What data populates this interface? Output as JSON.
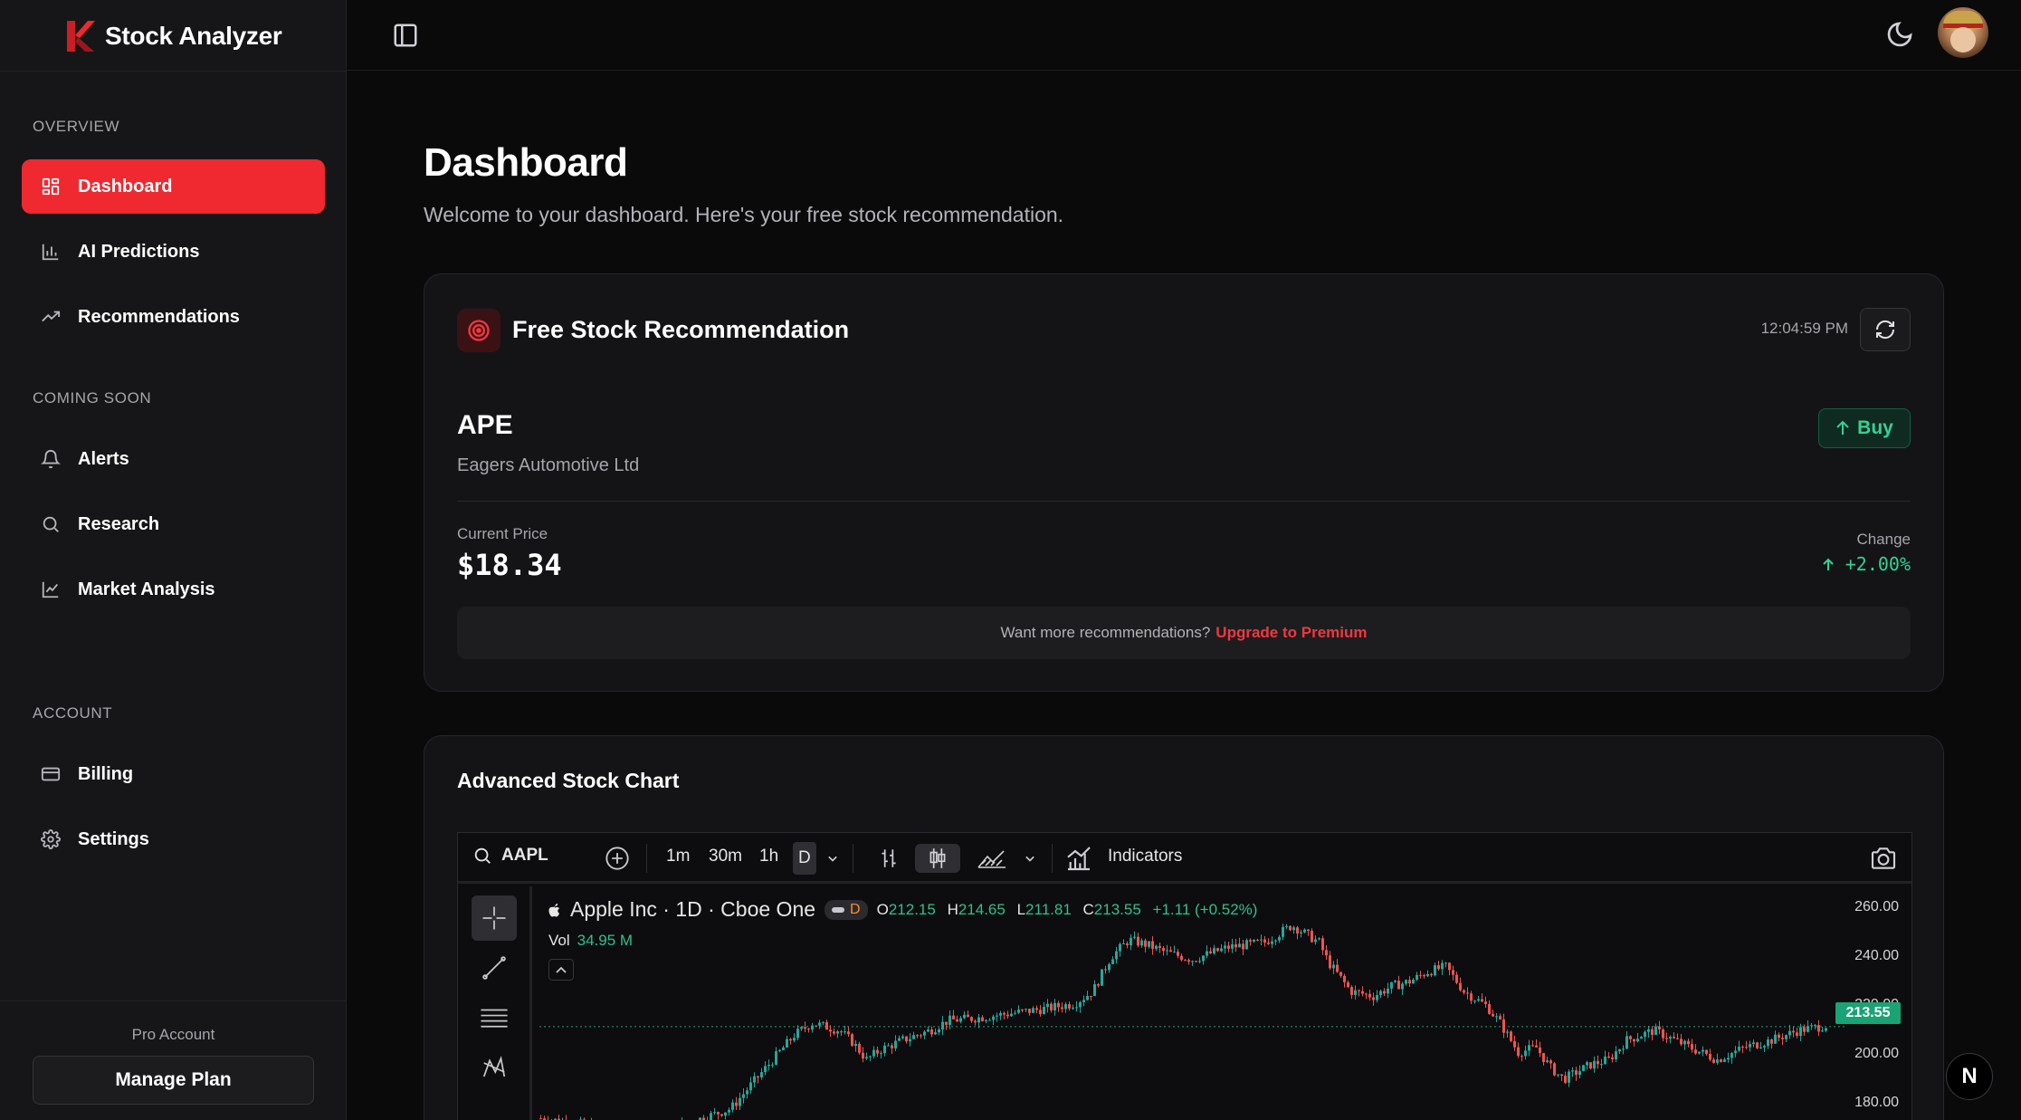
{
  "brand": {
    "name": "Stock Analyzer",
    "accent": "#f0282f"
  },
  "sidebar": {
    "sections": [
      {
        "title": "OVERVIEW",
        "items": [
          {
            "label": "Dashboard",
            "icon": "grid-icon",
            "active": true
          },
          {
            "label": "AI Predictions",
            "icon": "bar-chart-icon"
          },
          {
            "label": "Recommendations",
            "icon": "trending-up-icon"
          }
        ]
      },
      {
        "title": "COMING SOON",
        "items": [
          {
            "label": "Alerts",
            "icon": "bell-icon"
          },
          {
            "label": "Research",
            "icon": "search-icon"
          },
          {
            "label": "Market Analysis",
            "icon": "line-chart-icon"
          }
        ]
      },
      {
        "title": "ACCOUNT",
        "items": [
          {
            "label": "Billing",
            "icon": "credit-card-icon"
          },
          {
            "label": "Settings",
            "icon": "gear-icon"
          }
        ]
      }
    ],
    "footer": {
      "plan_label": "Pro Account",
      "manage_button": "Manage Plan"
    }
  },
  "main": {
    "title": "Dashboard",
    "subtitle": "Welcome to your dashboard. Here's your free stock recommendation."
  },
  "recommendation": {
    "title": "Free Stock Recommendation",
    "time": "12:04:59 PM",
    "ticker": "APE",
    "company": "Eagers Automotive Ltd",
    "action": "Buy",
    "price_label": "Current Price",
    "price": "$18.34",
    "change_label": "Change",
    "change": "+2.00%",
    "upgrade_text": "Want more recommendations?",
    "upgrade_link": "Upgrade to Premium",
    "positive_color": "#2fd596"
  },
  "advanced_chart": {
    "title": "Advanced Stock Chart",
    "symbol": "AAPL",
    "intervals": [
      "1m",
      "30m",
      "1h",
      "D"
    ],
    "selected_interval": "D",
    "indicators_label": "Indicators",
    "legend": {
      "name": "Apple Inc · 1D · Cboe One",
      "badge": "D",
      "open_label": "O",
      "open": "212.15",
      "high_label": "H",
      "high": "214.65",
      "low_label": "L",
      "low": "211.81",
      "close_label": "C",
      "close": "213.55",
      "change": "+1.11 (+0.52%)",
      "vol_label": "Vol",
      "vol": "34.95 M"
    },
    "y_ticks": [
      "260.00",
      "240.00",
      "220.00",
      "200.00",
      "180.00"
    ],
    "last_price": "213.55"
  },
  "n_badge": "N"
}
